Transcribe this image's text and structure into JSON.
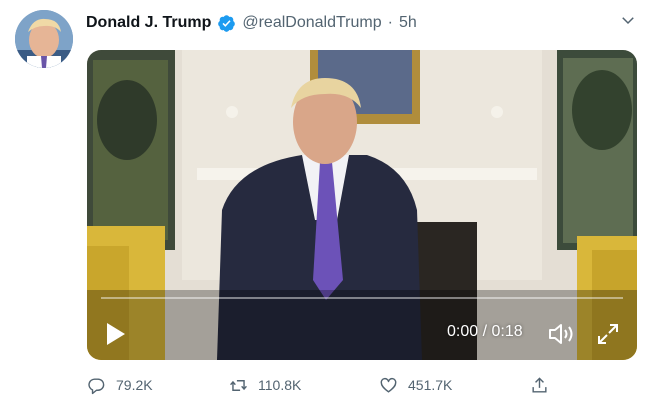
{
  "tweet": {
    "author_name": "Donald J. Trump",
    "handle": "@realDonaldTrump",
    "separator": "·",
    "time_ago": "5h",
    "verified": true
  },
  "video": {
    "current_time": "0:00",
    "duration": "0:18",
    "time_display": "0:00 / 0:18",
    "progress_fraction": 0
  },
  "actions": {
    "reply_count": "79.2K",
    "retweet_count": "110.8K",
    "like_count": "451.7K"
  },
  "icons": {
    "verified": "verified-badge-icon",
    "more": "chevron-down-icon",
    "play": "play-icon",
    "volume": "volume-icon",
    "fullscreen": "fullscreen-icon",
    "reply": "reply-icon",
    "retweet": "retweet-icon",
    "like": "heart-icon",
    "share": "share-icon"
  },
  "colors": {
    "accent": "#1d9bf0",
    "text_primary": "#0f1419",
    "text_secondary": "#536471"
  }
}
